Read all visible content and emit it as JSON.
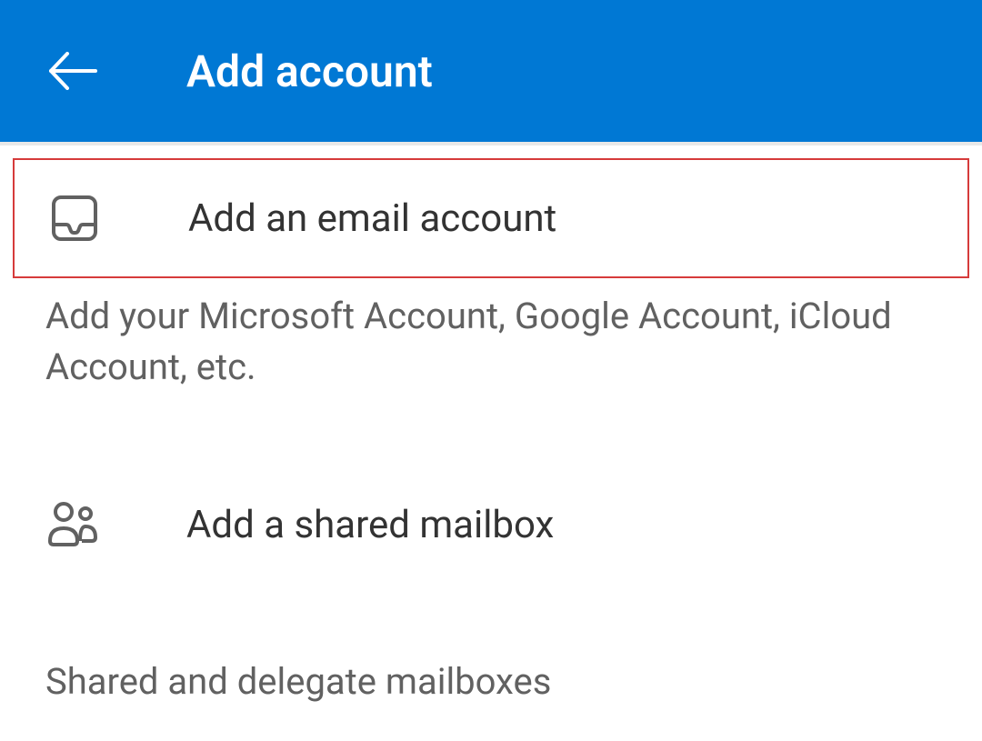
{
  "header": {
    "title": "Add account"
  },
  "options": {
    "emailAccount": {
      "label": "Add an email account",
      "description": "Add your Microsoft Account, Google Account, iCloud Account, etc."
    },
    "sharedMailbox": {
      "label": "Add a shared mailbox",
      "description": "Shared and delegate mailboxes"
    }
  }
}
